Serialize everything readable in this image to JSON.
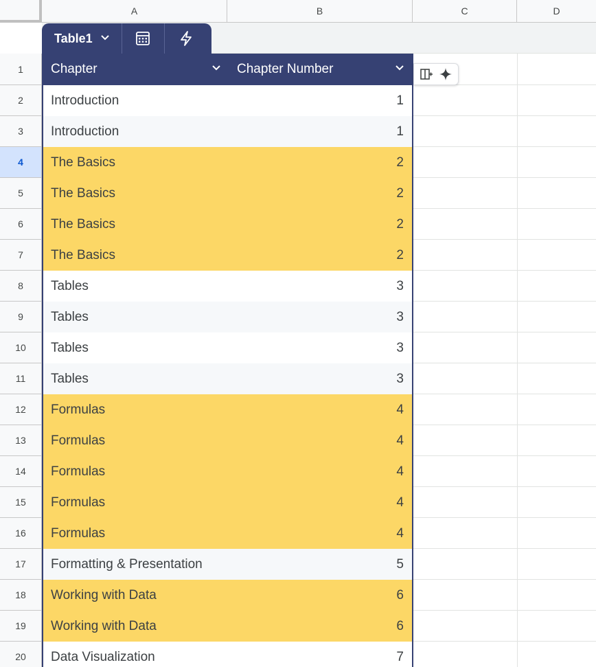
{
  "columns": [
    "A",
    "B",
    "C",
    "D"
  ],
  "rows": [
    "1",
    "2",
    "3",
    "4",
    "5",
    "6",
    "7",
    "8",
    "9",
    "10",
    "11",
    "12",
    "13",
    "14",
    "15",
    "16",
    "17",
    "18",
    "19",
    "20"
  ],
  "active_row": "4",
  "table": {
    "name": "Table1",
    "headers": [
      "Chapter",
      "Chapter Number"
    ],
    "rows": [
      {
        "chapter": "Introduction",
        "number": "1",
        "highlight": false
      },
      {
        "chapter": "Introduction",
        "number": "1",
        "highlight": false
      },
      {
        "chapter": "The Basics",
        "number": "2",
        "highlight": true
      },
      {
        "chapter": "The Basics",
        "number": "2",
        "highlight": true
      },
      {
        "chapter": "The Basics",
        "number": "2",
        "highlight": true
      },
      {
        "chapter": "The Basics",
        "number": "2",
        "highlight": true
      },
      {
        "chapter": "Tables",
        "number": "3",
        "highlight": false
      },
      {
        "chapter": "Tables",
        "number": "3",
        "highlight": false
      },
      {
        "chapter": "Tables",
        "number": "3",
        "highlight": false
      },
      {
        "chapter": "Tables",
        "number": "3",
        "highlight": false
      },
      {
        "chapter": "Formulas",
        "number": "4",
        "highlight": true
      },
      {
        "chapter": "Formulas",
        "number": "4",
        "highlight": true
      },
      {
        "chapter": "Formulas",
        "number": "4",
        "highlight": true
      },
      {
        "chapter": "Formulas",
        "number": "4",
        "highlight": true
      },
      {
        "chapter": "Formulas",
        "number": "4",
        "highlight": true
      },
      {
        "chapter": "Formatting & Presentation",
        "number": "5",
        "highlight": false
      },
      {
        "chapter": "Working with Data",
        "number": "6",
        "highlight": true
      },
      {
        "chapter": "Working with Data",
        "number": "6",
        "highlight": true
      },
      {
        "chapter": "Data Visualization",
        "number": "7",
        "highlight": false
      }
    ]
  },
  "icons": {
    "tab_dropdown": "chevron-down-icon",
    "tab_calc": "calculator-icon",
    "tab_automation": "lightning-icon",
    "header_dropdown": "chevron-down-icon",
    "toolbar_add_column": "add-column-icon",
    "toolbar_ai": "sparkle-icon"
  },
  "colors": {
    "table_header": "#364173",
    "highlight": "#fcd766",
    "stripe": "#f6f8fa",
    "active_row_header": "#d3e3fd"
  }
}
